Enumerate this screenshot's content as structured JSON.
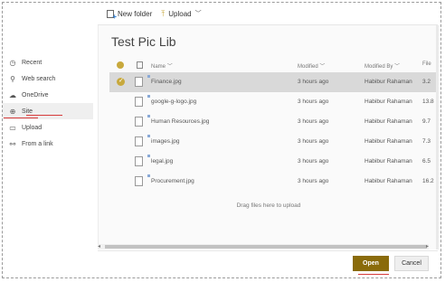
{
  "toolbar": {
    "new_folder_label": "New folder",
    "upload_label": "Upload"
  },
  "sidebar": {
    "items": [
      {
        "label": "Recent",
        "icon": "clock-icon"
      },
      {
        "label": "Web search",
        "icon": "search-icon"
      },
      {
        "label": "OneDrive",
        "icon": "cloud-icon"
      },
      {
        "label": "Site",
        "icon": "globe-icon",
        "selected": true
      },
      {
        "label": "Upload",
        "icon": "laptop-icon"
      },
      {
        "label": "From a link",
        "icon": "link-icon"
      }
    ]
  },
  "library": {
    "title": "Test Pic Lib"
  },
  "columns": {
    "name": "Name",
    "modified": "Modified",
    "modified_by": "Modified By",
    "size": "File"
  },
  "files": [
    {
      "name": "Finance.jpg",
      "modified": "3 hours ago",
      "by": "Habibur Rahaman",
      "size": "3.2",
      "selected": true
    },
    {
      "name": "google-g-logo.jpg",
      "modified": "3 hours ago",
      "by": "Habibur Rahaman",
      "size": "13.8"
    },
    {
      "name": "Human Resources.jpg",
      "modified": "3 hours ago",
      "by": "Habibur Rahaman",
      "size": "9.7"
    },
    {
      "name": "images.jpg",
      "modified": "3 hours ago",
      "by": "Habibur Rahaman",
      "size": "7.3"
    },
    {
      "name": "legal.jpg",
      "modified": "3 hours ago",
      "by": "Habibur Rahaman",
      "size": "6.5"
    },
    {
      "name": "Procurement.jpg",
      "modified": "3 hours ago",
      "by": "Habibur Rahaman",
      "size": "16.2"
    }
  ],
  "drag_hint": "Drag files here to upload",
  "buttons": {
    "open": "Open",
    "cancel": "Cancel"
  },
  "colors": {
    "accent": "#c8a93d",
    "open_button": "#8a6b0a",
    "annotation_red": "#d63b3b"
  }
}
